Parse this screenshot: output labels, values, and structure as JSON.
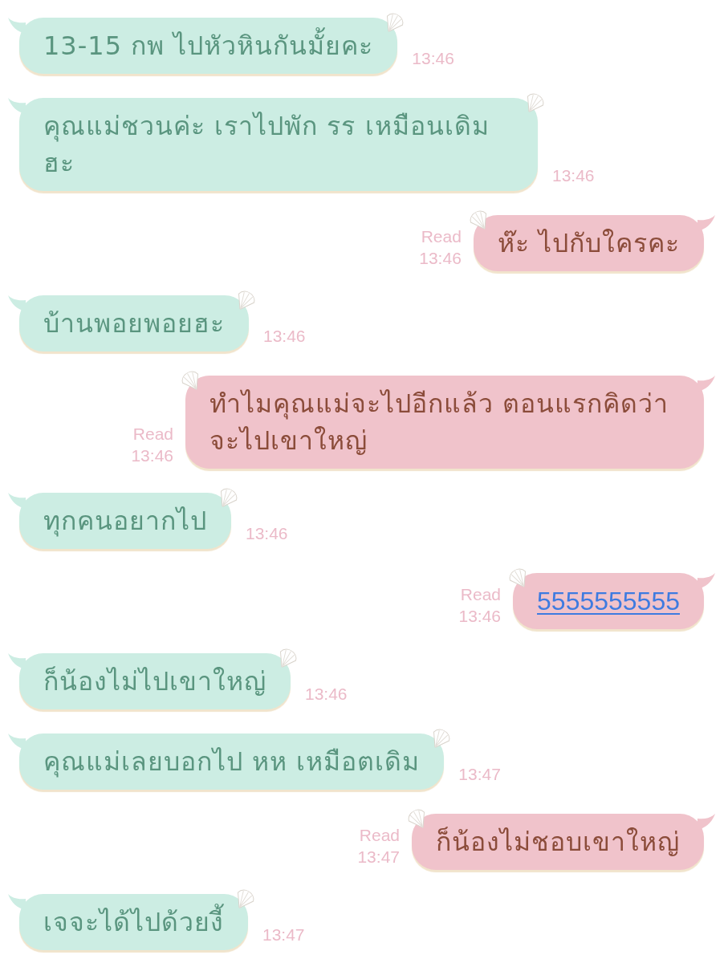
{
  "messages": [
    {
      "outgoing": false,
      "kind": "text",
      "text": "13-15 กพ ไปหัวหินกันมั้ยคะ",
      "time": "13:46"
    },
    {
      "outgoing": false,
      "kind": "text",
      "text": "คุณแม่ชวนค่ะ เราไปพัก รร เหมือนเดิมฮะ",
      "time": "13:46"
    },
    {
      "outgoing": true,
      "kind": "text",
      "text": "ห๊ะ ไปกับใครคะ",
      "status": "Read",
      "time": "13:46"
    },
    {
      "outgoing": false,
      "kind": "text",
      "text": "บ้านพอยพอยฮะ",
      "time": "13:46"
    },
    {
      "outgoing": true,
      "kind": "text",
      "text": "ทำไมคุณแม่จะไปอีกแล้ว ตอนแรกคิดว่าจะไปเขาใหญ่",
      "status": "Read",
      "time": "13:46"
    },
    {
      "outgoing": false,
      "kind": "text",
      "text": "ทุกคนอยากไป",
      "time": "13:46"
    },
    {
      "outgoing": true,
      "kind": "link",
      "text": "5555555555",
      "status": "Read",
      "time": "13:46"
    },
    {
      "outgoing": false,
      "kind": "text",
      "text": "ก็น้องไม่ไปเขาใหญ่",
      "time": "13:46"
    },
    {
      "outgoing": false,
      "kind": "text",
      "text": "คุณแม่เลยบอกไป หห เหมือตเดิม",
      "time": "13:47"
    },
    {
      "outgoing": true,
      "kind": "text",
      "text": "ก็น้องไม่ชอบเขาใหญ่",
      "status": "Read",
      "time": "13:47"
    },
    {
      "outgoing": false,
      "kind": "text",
      "text": "เจจะได้ไปด้วยงี้",
      "time": "13:47"
    }
  ]
}
